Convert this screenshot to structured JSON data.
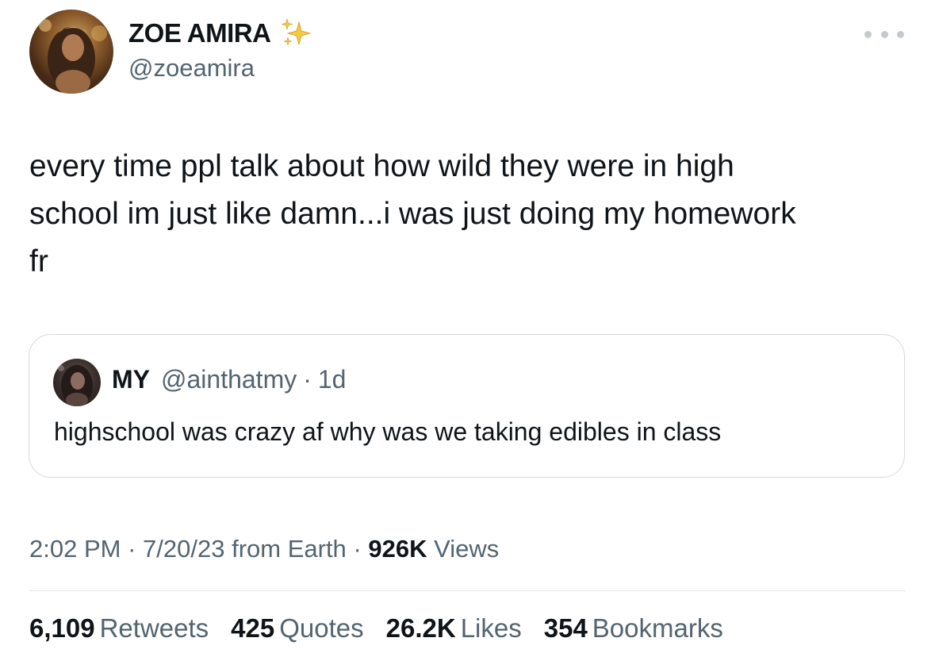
{
  "author": {
    "display_name": "ZOE AMIRA",
    "handle": "@zoeamira",
    "badge_icon": "sparkles-icon"
  },
  "tweet": {
    "text": "every time ppl talk about how wild they were in high\nschool im just like damn...i was just doing my homework\nfr"
  },
  "quoted_tweet": {
    "display_name": "MY",
    "handle": "@ainthatmy",
    "separator": "·",
    "time": "1d",
    "text": "highschool was crazy af why was we taking edibles in class"
  },
  "meta": {
    "time": "2:02 PM",
    "sep1": "·",
    "date": "7/20/23",
    "source": "from Earth",
    "sep2": "·",
    "views_count": "926K",
    "views_label": "Views"
  },
  "stats": [
    {
      "count": "6,109",
      "label": "Retweets"
    },
    {
      "count": "425",
      "label": "Quotes"
    },
    {
      "count": "26.2K",
      "label": "Likes"
    },
    {
      "count": "354",
      "label": "Bookmarks"
    }
  ],
  "colors": {
    "text_primary": "#0f1419",
    "text_secondary": "#536471",
    "border": "#d5dade",
    "sparkle": "#f4c430"
  }
}
